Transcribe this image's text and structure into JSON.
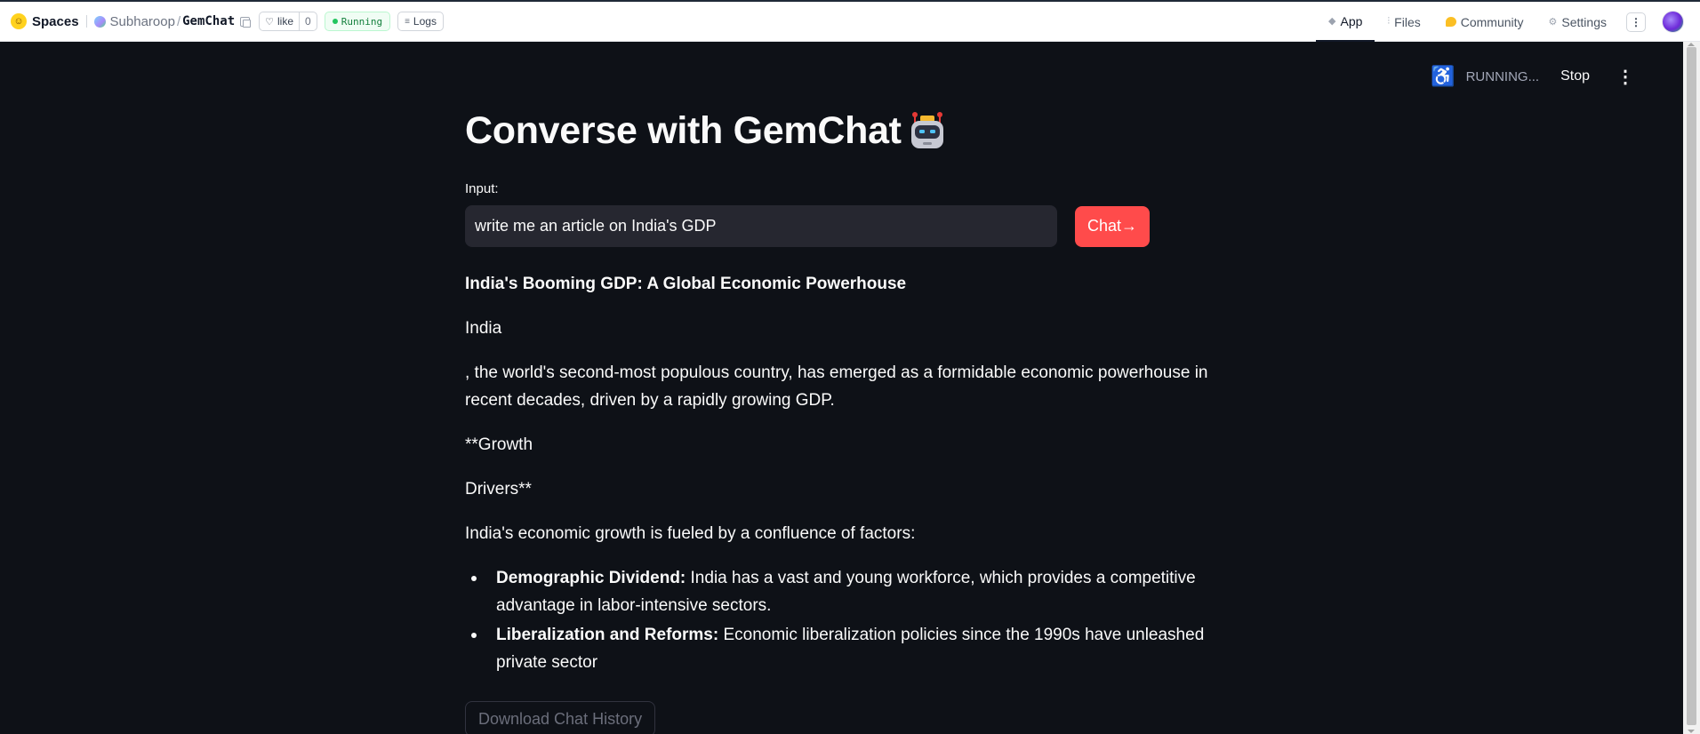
{
  "topbar": {
    "spaces_label": "Spaces",
    "owner": "Subharoop",
    "separator": "/",
    "repo": "GemChat",
    "like_label": "like",
    "like_count": "0",
    "status": "Running",
    "logs_label": "Logs",
    "tabs": [
      {
        "label": "App",
        "icon": "cube-icon",
        "active": true
      },
      {
        "label": "Files",
        "icon": "files-icon",
        "active": false
      },
      {
        "label": "Community",
        "icon": "community-icon",
        "active": false
      },
      {
        "label": "Settings",
        "icon": "gear-icon",
        "active": false
      }
    ],
    "more_label": "⋮"
  },
  "app_status": {
    "running_text": "RUNNING...",
    "stop_label": "Stop",
    "menu_label": "⋮"
  },
  "main": {
    "title": "Converse with GemChat",
    "input_label": "Input:",
    "input_value": "write me an article on India's GDP",
    "chat_button": "Chat→",
    "article": {
      "headline": "India's Booming GDP: A Global Economic Powerhouse",
      "paragraphs": [
        "India",
        ", the world's second-most populous country, has emerged as a formidable economic powerhouse in recent decades, driven by a rapidly growing GDP.",
        "**Growth",
        "Drivers**",
        "India's economic growth is fueled by a confluence of factors:"
      ],
      "bullets": [
        {
          "bold": "Demographic Dividend:",
          "text": " India has a vast and young workforce, which provides a competitive advantage in labor-intensive sectors."
        },
        {
          "bold": "Liberalization and Reforms:",
          "text": " Economic liberalization policies since the 1990s have unleashed private sector"
        }
      ]
    },
    "download_button": "Download Chat History"
  },
  "colors": {
    "app_background": "#0e1117",
    "input_background": "#262730",
    "primary_button": "#ff4b4b",
    "running_badge": "#22c55e"
  }
}
